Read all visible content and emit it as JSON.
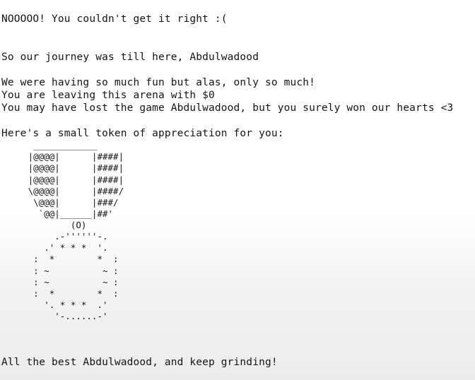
{
  "terminal": {
    "lines": [
      "NOOOOO! You couldn't get it right :(",
      "So our journey was till here, Abdulwadood",
      "We were having so much fun but alas, only so much!",
      "You are leaving this arena with $0",
      "You may have lost the game Abdulwadood, but you surely won our hearts <3",
      "Here's a small token of appreciation for you:",
      "All the best Abdulwadood, and keep grinding!"
    ],
    "trophy_art": "      ____________\n     |@@@@|      |####|\n     |@@@@|      |####|\n     |@@@@|      |####|\n     \\@@@@|      |####/\n      \\@@@|      |###/\n       `@@|______|##'\n             (O)",
    "medal_art": "          .-''''''-.\n        .' * * *  '.\n      :  *        *  :\n      : ~          ~ :\n      : ~          ~ :\n      :  *        *  :\n        '. * * *  .'\n          '-......-'"
  }
}
